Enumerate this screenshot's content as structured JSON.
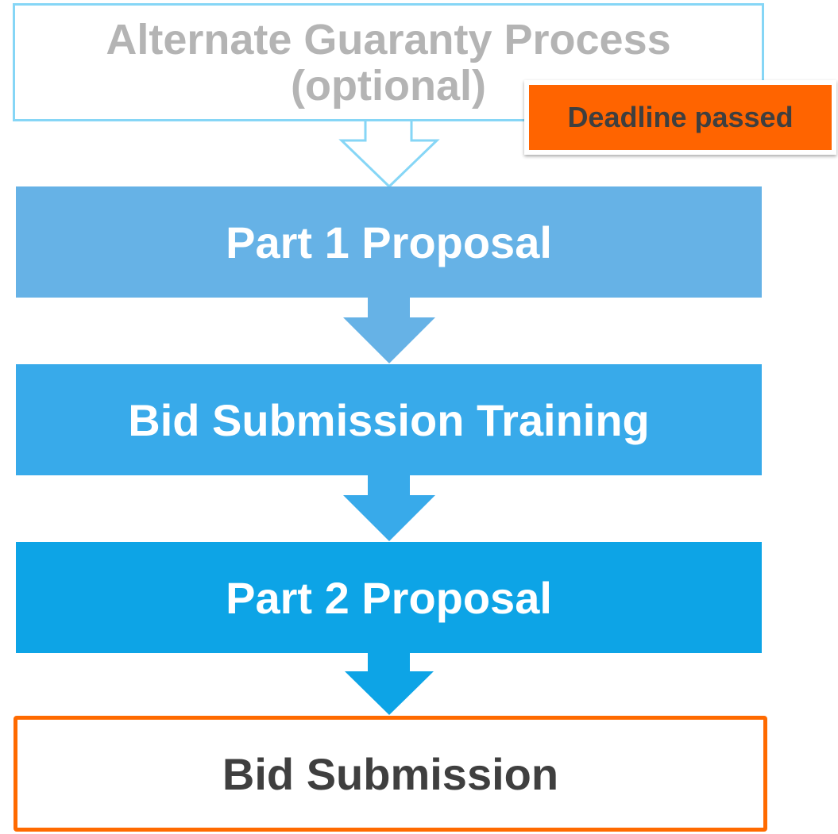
{
  "diagram": {
    "steps": [
      {
        "id": "alternate-guaranty",
        "lines": [
          "Alternate Guaranty Process",
          "(optional)"
        ]
      },
      {
        "id": "part-1-proposal",
        "label": "Part 1 Proposal"
      },
      {
        "id": "bid-submission-training",
        "label": "Bid Submission Training"
      },
      {
        "id": "part-2-proposal",
        "label": "Part 2 Proposal"
      },
      {
        "id": "bid-submission",
        "label": "Bid Submission"
      }
    ],
    "badge": {
      "label": "Deadline passed"
    }
  },
  "colors": {
    "outline_light_blue": "#86d6f6",
    "step_1_fill": "#66b2e6",
    "step_2_fill": "#38aaea",
    "step_3_fill": "#0da4e6",
    "accent_orange": "#ff6a00",
    "muted_text": "#b4b4b4",
    "dark_text": "#3f3f3f"
  }
}
